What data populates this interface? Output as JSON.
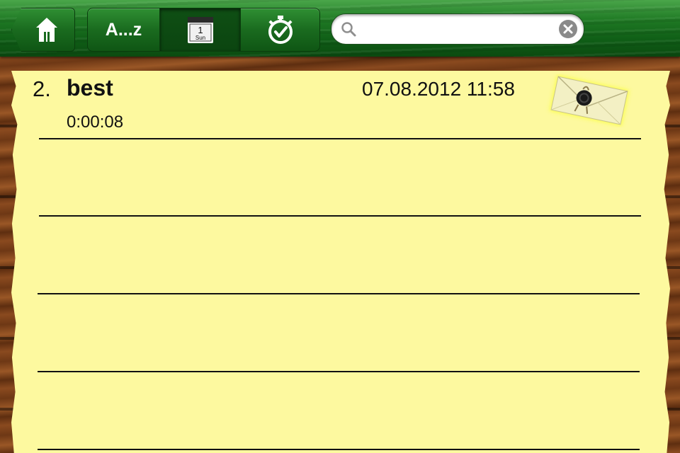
{
  "toolbar": {
    "home_icon": "home-icon",
    "sort_alpha_label": "A...z",
    "sort_date_icon": "calendar-icon",
    "calendar_day": "1",
    "calendar_weekday": "Sun",
    "sort_duration_icon": "stopwatch-icon",
    "search": {
      "placeholder": "",
      "value": ""
    }
  },
  "entry": {
    "number": "2.",
    "title": "best",
    "datetime": "07.08.2012 11:58",
    "duration": "0:00:08",
    "attachment_icon": "sealed-envelope-icon"
  },
  "colors": {
    "toolbar_green": "#1f7a24",
    "paper_yellow": "#fdf99f",
    "wood_brown": "#8a4a1f"
  }
}
